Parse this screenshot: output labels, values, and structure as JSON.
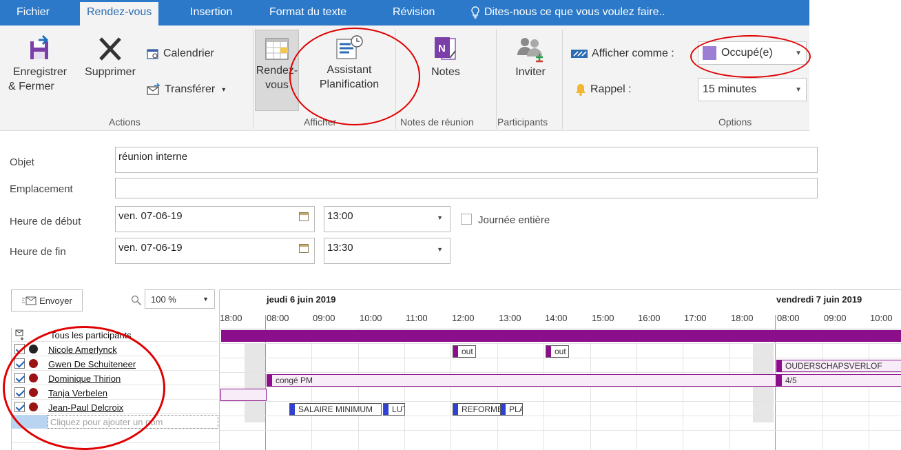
{
  "tabs": [
    "Fichier",
    "Rendez-vous",
    "Insertion",
    "Format du texte",
    "Révision"
  ],
  "tell_me": "Dites-nous ce que vous voulez faire..",
  "ribbon": {
    "save_close_line1": "Enregistrer",
    "save_close_line2": "& Fermer",
    "delete": "Supprimer",
    "calendar": "Calendrier",
    "forward": "Transférer",
    "appointment_line1": "Rendez-",
    "appointment_line2": "vous",
    "assistant_line1": "Assistant",
    "assistant_line2": "Planification",
    "notes": "Notes",
    "invite": "Inviter",
    "show_as_label": "Afficher comme :",
    "show_as_value": "Occupé(e)",
    "reminder_label": "Rappel :",
    "reminder_value": "15 minutes",
    "groups": {
      "actions": "Actions",
      "show": "Afficher",
      "meeting_notes": "Notes de réunion",
      "participants": "Participants",
      "options": "Options"
    }
  },
  "form": {
    "subject_label": "Objet",
    "subject_value": "réunion interne",
    "location_label": "Emplacement",
    "location_value": "",
    "start_label": "Heure de début",
    "start_date": "ven. 07-06-19",
    "start_time": "13:00",
    "all_day": "Journée entière",
    "end_label": "Heure de fin",
    "end_date": "ven. 07-06-19",
    "end_time": "13:30"
  },
  "scheduling": {
    "send": "Envoyer",
    "zoom": "100 %",
    "day1": "jeudi 6 juin 2019",
    "day2": "vendredi 7 juin 2019",
    "hours": [
      "18:00",
      "08:00",
      "09:00",
      "10:00",
      "11:00",
      "12:00",
      "13:00",
      "14:00",
      "15:00",
      "16:00",
      "17:00",
      "18:00",
      "08:00",
      "09:00",
      "10:00"
    ],
    "all_attendees": "Tous les participants",
    "add_name_placeholder": "Cliquez pour ajouter un nom",
    "participants": [
      {
        "name": "Nicole Amerlynck",
        "role": "organizer",
        "checked": true
      },
      {
        "name": "Gwen De Schuiteneer",
        "role": "required",
        "checked": true
      },
      {
        "name": "Dominique Thirion",
        "role": "required",
        "checked": true
      },
      {
        "name": "Tanja Verbelen",
        "role": "required",
        "checked": true
      },
      {
        "name": "Jean-Paul Delcroix",
        "role": "required",
        "checked": true
      }
    ],
    "events": {
      "out1": "out",
      "out2": "out",
      "ouderschap": "OUDERSCHAPSVERLOF",
      "conge": "congé PM",
      "fourfive": "4/5",
      "salaire": "SALAIRE MINIMUM",
      "lut": "LUT",
      "reforme": "REFORME",
      "pla": "PLA"
    }
  },
  "colors": {
    "ribbon_blue": "#2b79c8",
    "busy_purple": "#9b7fd4",
    "out_of_office": "#8b0e8b",
    "busy_blue": "#3040d0",
    "annotation_red": "#e00000"
  }
}
